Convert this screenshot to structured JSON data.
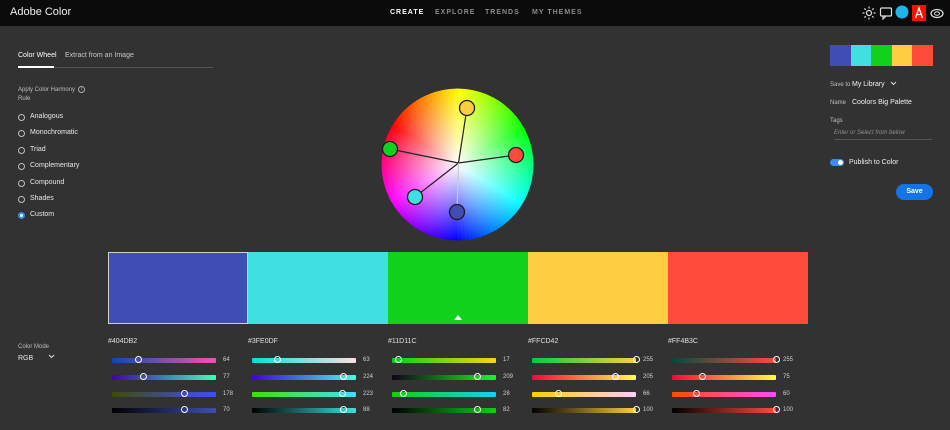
{
  "header": {
    "app_title": "Adobe Color",
    "nav": [
      "CREATE",
      "EXPLORE",
      "TRENDS",
      "MY THEMES"
    ],
    "active_nav": "CREATE"
  },
  "tabs": {
    "color_wheel": "Color Wheel",
    "extract": "Extract from an Image"
  },
  "harmony": {
    "title": "Apply Color Harmony Rule",
    "options": [
      "Analogous",
      "Monochromatic",
      "Triad",
      "Complementary",
      "Compound",
      "Shades",
      "Custom"
    ],
    "selected": "Custom"
  },
  "color_mode": {
    "label": "Color Mode",
    "value": "RGB"
  },
  "swatches": [
    {
      "hex": "#404DB2",
      "rgb": [
        64,
        77,
        178,
        70
      ]
    },
    {
      "hex": "#3FE0DF",
      "rgb": [
        63,
        224,
        223,
        88
      ]
    },
    {
      "hex": "#11D11C",
      "rgb": [
        17,
        209,
        28,
        82
      ]
    },
    {
      "hex": "#FFCD42",
      "rgb": [
        255,
        205,
        66,
        100
      ]
    },
    {
      "hex": "#FF4B3C",
      "rgb": [
        255,
        75,
        60,
        100
      ]
    }
  ],
  "colors": {
    "swatch_1": "#404DB2",
    "swatch_2": "#3FE0DF",
    "swatch_3": "#11D11C",
    "swatch_4": "#FFCD42",
    "swatch_5": "#FF4B3C",
    "accent": "#1473E6",
    "background": "#323232",
    "topbar": "#0B0B0B"
  },
  "selected_swatch": 3,
  "sidebar": {
    "save_to_label": "Save to",
    "library": "My Library",
    "name_label": "Name",
    "name_value": "Coolors Big Palette",
    "tags_label": "Tags",
    "tags_placeholder": "Enter or Select from below",
    "publish_label": "Publish to Color",
    "publish_on": true,
    "save_label": "Save"
  }
}
